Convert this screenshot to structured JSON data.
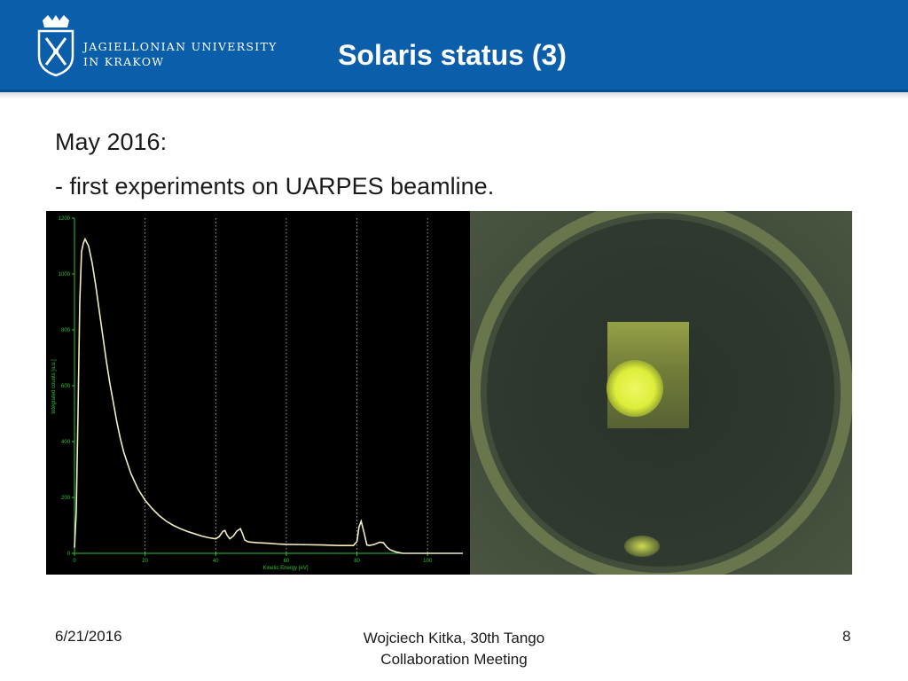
{
  "header": {
    "university_line1": "JAGIELLONIAN UNIVERSITY",
    "university_line2": "IN KRAKOW",
    "title": "Solaris status (3)",
    "bar_color": "#0b5ea9"
  },
  "body": {
    "line1": "May 2016:",
    "line2": "- first experiments on UARPES beamline."
  },
  "chart_data": {
    "type": "line",
    "xlabel": "Kinetic Energy [eV]",
    "ylabel": "Integrated counts [a.u.]",
    "xlim": [
      0,
      110
    ],
    "ylim": [
      0,
      1200
    ],
    "x_ticks": [
      "0",
      "20",
      "40",
      "60",
      "80",
      "100"
    ],
    "y_ticks": [
      "0",
      "200",
      "400",
      "600",
      "800",
      "1000",
      "1200"
    ],
    "grid": "vertical dotted lines at x ticks",
    "line_color": "#f2eec0",
    "series": [
      {
        "x": [
          0,
          0.5,
          1,
          1.5,
          2,
          2.5,
          3,
          4,
          5,
          6,
          7,
          8,
          9,
          10,
          11,
          12,
          13,
          14,
          16,
          18,
          20,
          22,
          24,
          26,
          28,
          30,
          32,
          34,
          36,
          38,
          40,
          41,
          42,
          42.6,
          43.2,
          44,
          45,
          46,
          47,
          47.6,
          48.2,
          49,
          50,
          52,
          55,
          58,
          60,
          65,
          70,
          75,
          79,
          80,
          80.6,
          81.2,
          82,
          82.8,
          83.5,
          85,
          86.5,
          87.5,
          88.5,
          89.5,
          91,
          93,
          100,
          110
        ],
        "y": [
          20,
          150,
          500,
          900,
          1080,
          1110,
          1125,
          1100,
          1040,
          960,
          870,
          780,
          690,
          610,
          540,
          470,
          410,
          360,
          285,
          230,
          190,
          160,
          135,
          115,
          100,
          88,
          78,
          70,
          62,
          56,
          52,
          60,
          78,
          82,
          65,
          52,
          62,
          80,
          88,
          70,
          48,
          42,
          40,
          38,
          36,
          33,
          32,
          31,
          30,
          28,
          28,
          42,
          95,
          115,
          75,
          30,
          28,
          32,
          40,
          38,
          22,
          12,
          5,
          0,
          0,
          0
        ]
      }
    ]
  },
  "image": {
    "ring_color": "#6e7a4e",
    "spot_color": "#e6f542",
    "background_color": "#3d4838"
  },
  "footer": {
    "date": "6/21/2016",
    "center_line1": "Wojciech Kitka, 30th Tango",
    "center_line2": "Collaboration Meeting",
    "page": "8"
  }
}
